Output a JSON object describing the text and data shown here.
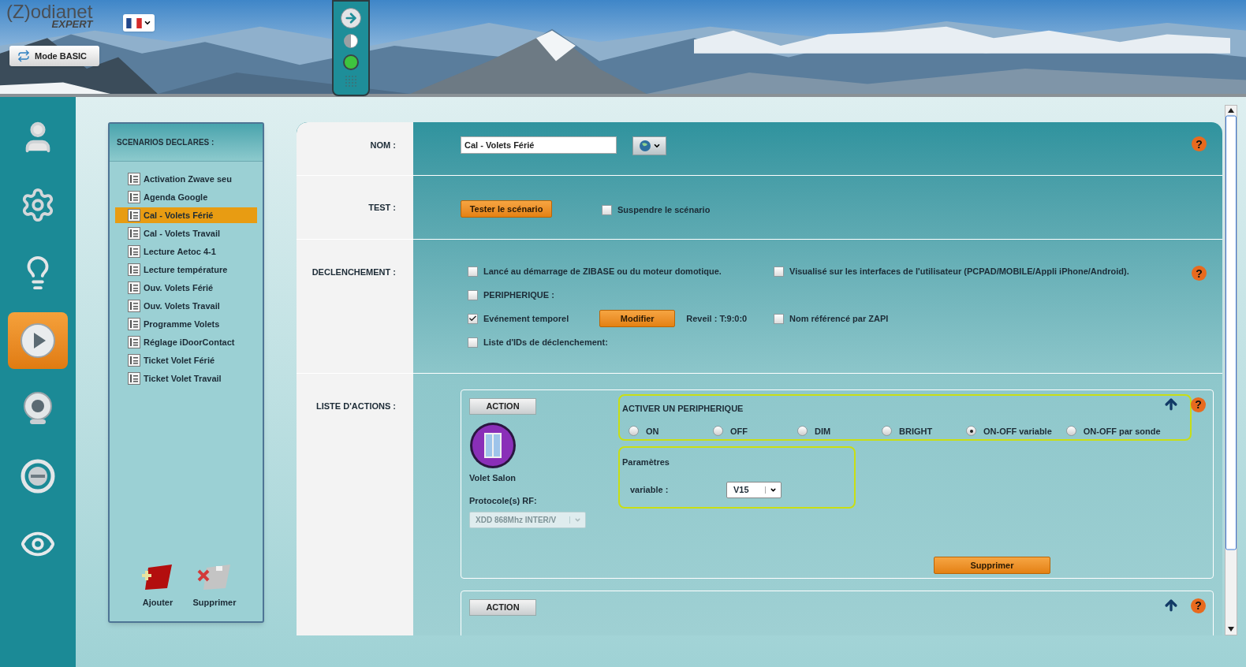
{
  "header": {
    "logo": {
      "wordmark": "(Z)odianet",
      "edition": "EXPERT"
    },
    "mode_button": "Mode BASIC"
  },
  "nav": [
    {
      "kind": "user",
      "selected": false
    },
    {
      "kind": "gears",
      "selected": false
    },
    {
      "kind": "bulb",
      "selected": false
    },
    {
      "kind": "play",
      "selected": true
    },
    {
      "kind": "webcam",
      "selected": false
    },
    {
      "kind": "ring",
      "selected": false
    },
    {
      "kind": "eye",
      "selected": false
    }
  ],
  "scenarios": {
    "title": "SCENARIOS DECLARES :",
    "items": [
      {
        "label": "Activation Zwave seu",
        "selected": false
      },
      {
        "label": "Agenda Google",
        "selected": false
      },
      {
        "label": "Cal - Volets Férié",
        "selected": true
      },
      {
        "label": "Cal - Volets Travail",
        "selected": false
      },
      {
        "label": "Lecture Aetoc 4-1",
        "selected": false
      },
      {
        "label": "Lecture température",
        "selected": false
      },
      {
        "label": "Ouv. Volets Férié",
        "selected": false
      },
      {
        "label": "Ouv. Volets Travail",
        "selected": false
      },
      {
        "label": "Programme Volets",
        "selected": false
      },
      {
        "label": "Réglage iDoorContact",
        "selected": false
      },
      {
        "label": "Ticket Volet Férié",
        "selected": false
      },
      {
        "label": "Ticket Volet Travail",
        "selected": false
      }
    ],
    "actions": [
      {
        "kind": "add",
        "label": "Ajouter"
      },
      {
        "kind": "delete",
        "label": "Supprimer"
      }
    ]
  },
  "form": {
    "name": {
      "label": "NOM :",
      "value": "Cal - Volets Férié",
      "help": "?"
    },
    "test": {
      "label": "TEST :",
      "button": "Tester le scénario",
      "suspend": {
        "label": "Suspendre le scénario",
        "checked": false
      }
    },
    "trigger": {
      "label": "DECLENCHEMENT :",
      "help": "?",
      "rows": [
        [
          {
            "label": "Lancé au démarrage de ZIBASE ou du moteur domotique.",
            "checked": false
          },
          {
            "label": "Visualisé sur les interfaces de l'utilisateur (PCPAD/MOBILE/Appli iPhone/Android).",
            "checked": false
          }
        ],
        [
          {
            "label": "PERIPHERIQUE :",
            "checked": false
          }
        ],
        [
          {
            "label": "Evénement temporel",
            "checked": true,
            "button": "Modifier",
            "info": "Reveil : T:9:0:0"
          },
          {
            "label": "Nom référencé par ZAPI",
            "checked": false
          }
        ],
        [
          {
            "label": "Liste d'IDs de déclenchement:",
            "checked": false
          }
        ]
      ]
    },
    "actions": {
      "label": "LISTE D'ACTIONS :",
      "items": [
        {
          "button": "ACTION",
          "help": "?",
          "device": "Volet Salon",
          "protocol": {
            "label": "Protocole(s) RF:",
            "value": "XDD 868Mhz INTER/V",
            "disabled": true
          },
          "mode": {
            "title": "ACTIVER UN PERIPHERIQUE",
            "options": [
              {
                "label": "ON",
                "selected": false
              },
              {
                "label": "OFF",
                "selected": false
              },
              {
                "label": "DIM",
                "selected": false
              },
              {
                "label": "BRIGHT",
                "selected": false
              },
              {
                "label": "ON-OFF variable",
                "selected": true
              },
              {
                "label": "ON-OFF par sonde",
                "selected": false
              }
            ]
          },
          "params": {
            "title": "Paramètres",
            "fields": [
              {
                "label": "variable :",
                "value": "V15"
              }
            ]
          },
          "delete": "Supprimer"
        },
        {
          "button": "ACTION",
          "help": "?"
        }
      ]
    }
  }
}
